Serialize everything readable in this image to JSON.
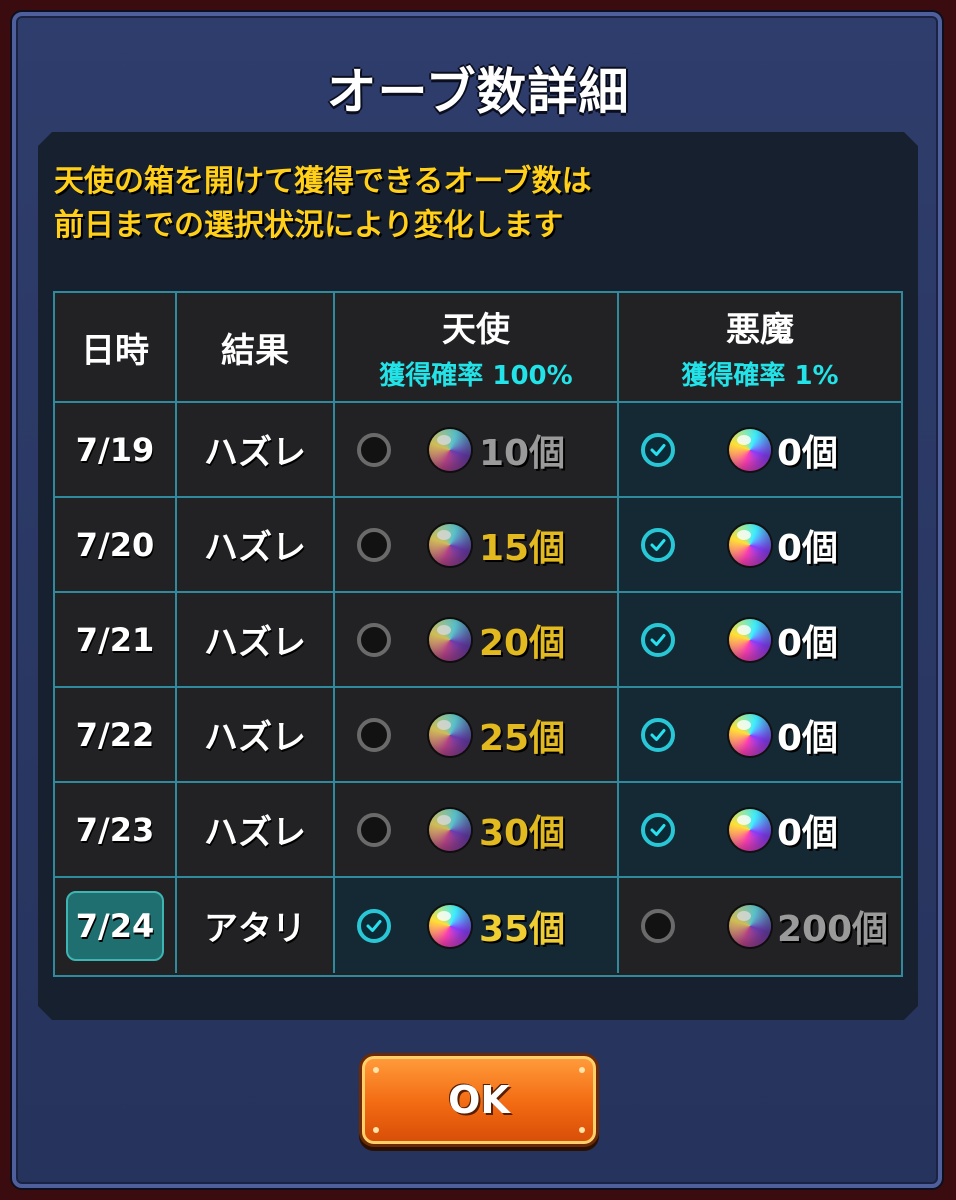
{
  "dialog": {
    "title": "オーブ数詳細",
    "notice_line1": "天使の箱を開けて獲得できるオーブ数は",
    "notice_line2": "前日までの選択状況により変化します"
  },
  "table": {
    "headers": {
      "date": "日時",
      "result": "結果",
      "angel": "天使",
      "angel_rate": "獲得確率 100%",
      "devil": "悪魔",
      "devil_rate": "獲得確率 1%"
    },
    "rows": [
      {
        "date": "7/19",
        "result": "ハズレ",
        "angel_count": "10個",
        "angel_selected": false,
        "devil_count": "0個",
        "devil_selected": true
      },
      {
        "date": "7/20",
        "result": "ハズレ",
        "angel_count": "15個",
        "angel_selected": false,
        "devil_count": "0個",
        "devil_selected": true
      },
      {
        "date": "7/21",
        "result": "ハズレ",
        "angel_count": "20個",
        "angel_selected": false,
        "devil_count": "0個",
        "devil_selected": true
      },
      {
        "date": "7/22",
        "result": "ハズレ",
        "angel_count": "25個",
        "angel_selected": false,
        "devil_count": "0個",
        "devil_selected": true
      },
      {
        "date": "7/23",
        "result": "ハズレ",
        "angel_count": "30個",
        "angel_selected": false,
        "devil_count": "0個",
        "devil_selected": true
      },
      {
        "date": "7/24",
        "result": "アタリ",
        "angel_count": "35個",
        "angel_selected": true,
        "devil_count": "200個",
        "devil_selected": false
      }
    ]
  },
  "buttons": {
    "ok_label": "OK"
  },
  "colors": {
    "notice": "#ffcf1a",
    "rate": "#22e3e8",
    "count_gold": "#e2b91f",
    "count_gray": "#9a9a9a",
    "count_white": "#ffffff"
  }
}
